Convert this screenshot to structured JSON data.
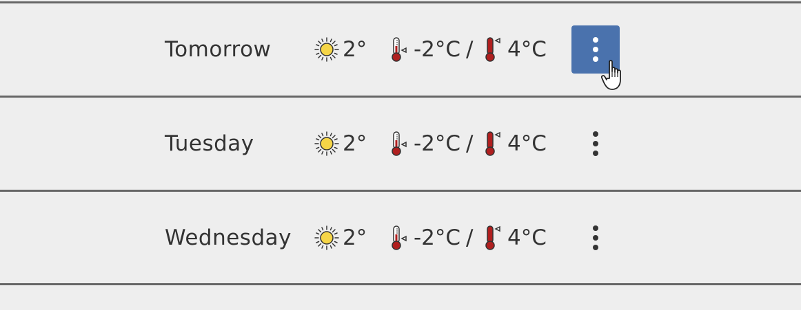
{
  "forecast": [
    {
      "day": "Tomorrow",
      "uv": "2°",
      "temp_low": "-2°C",
      "separator": "/",
      "temp_high": "4°C",
      "menu_active": true
    },
    {
      "day": "Tuesday",
      "uv": "2°",
      "temp_low": "-2°C",
      "separator": "/",
      "temp_high": "4°C",
      "menu_active": false
    },
    {
      "day": "Wednesday",
      "uv": "2°",
      "temp_low": "-2°C",
      "separator": "/",
      "temp_high": "4°C",
      "menu_active": false
    }
  ],
  "icons": {
    "uv": "sun-icon",
    "temp_low": "thermometer-low-icon",
    "temp_high": "thermometer-high-icon",
    "menu": "more-vertical-icon",
    "cursor": "hand-pointer-cursor-icon"
  },
  "colors": {
    "background": "#eeeeee",
    "divider": "#666666",
    "text": "#333333",
    "menu_active_bg": "#4a72ad",
    "sun": "#f5d547",
    "thermometer": "#b01f1f"
  }
}
